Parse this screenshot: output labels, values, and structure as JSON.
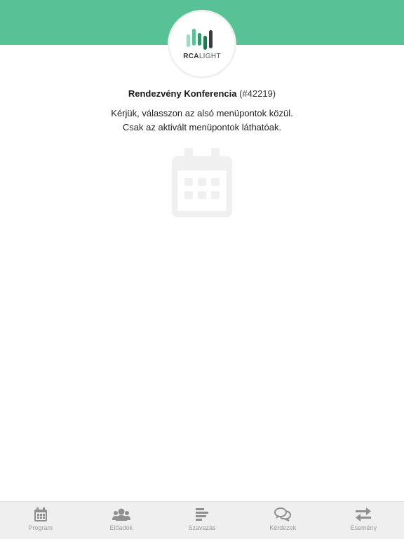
{
  "header": {
    "logo": {
      "text_bold": "RCA",
      "text_light": "LIGHT",
      "bar_colors": [
        "#8fd3b1",
        "#57c394",
        "#2e9a6a",
        "#1f7a50",
        "#444444"
      ]
    },
    "brand_color": "#57c394"
  },
  "main": {
    "event_name": "Rendezvény Konferencia",
    "event_id": "(#42219)",
    "instruction_line1": "Kérjük, válasszon az alsó menüpontok közül.",
    "instruction_line2": "Csak az aktivált menüpontok láthatóak.",
    "placeholder_icon": "calendar-icon"
  },
  "tabbar": {
    "items": [
      {
        "label": "Program",
        "icon": "calendar-icon"
      },
      {
        "label": "Előadók",
        "icon": "users-icon"
      },
      {
        "label": "Szavazás",
        "icon": "poll-icon"
      },
      {
        "label": "Kérdezek",
        "icon": "chat-icon"
      },
      {
        "label": "Esemény",
        "icon": "exchange-icon"
      }
    ]
  }
}
